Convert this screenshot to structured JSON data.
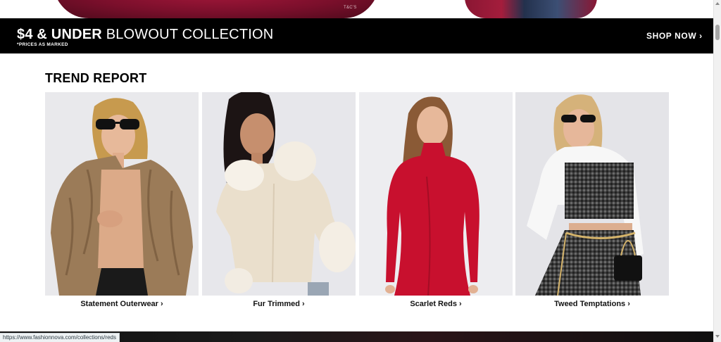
{
  "hero": {
    "tc_label": "T&C'S"
  },
  "promo": {
    "title_bold": "$4 & UNDER",
    "title_light": "BLOWOUT COLLECTION",
    "subtitle": "*PRICES AS MARKED",
    "cta_label": "SHOP NOW ›"
  },
  "trend_report": {
    "heading": "TREND REPORT",
    "cards": [
      {
        "label": "Statement Outerwear ›",
        "image": "model in shaggy brown faux fur jacket with sunglasses",
        "accent": "#8a6f50"
      },
      {
        "label": "Fur Trimmed ›",
        "image": "model in cream cardigan with fur collar and cuffs",
        "accent": "#efe2cf"
      },
      {
        "label": "Scarlet Reds ›",
        "image": "model in red long-sleeve mock-neck mini dress",
        "accent": "#c8102e"
      },
      {
        "label": "Tweed Temptations ›",
        "image": "model in white shirt with black tweed bustier and mini skirt",
        "accent": "#3a3a3a"
      }
    ]
  },
  "status_bar": {
    "url": "https://www.fashionnova.com/collections/reds"
  },
  "colors": {
    "banner_bg": "#000000",
    "page_bg": "#ffffff",
    "card_bg": "#e6e6ea"
  }
}
